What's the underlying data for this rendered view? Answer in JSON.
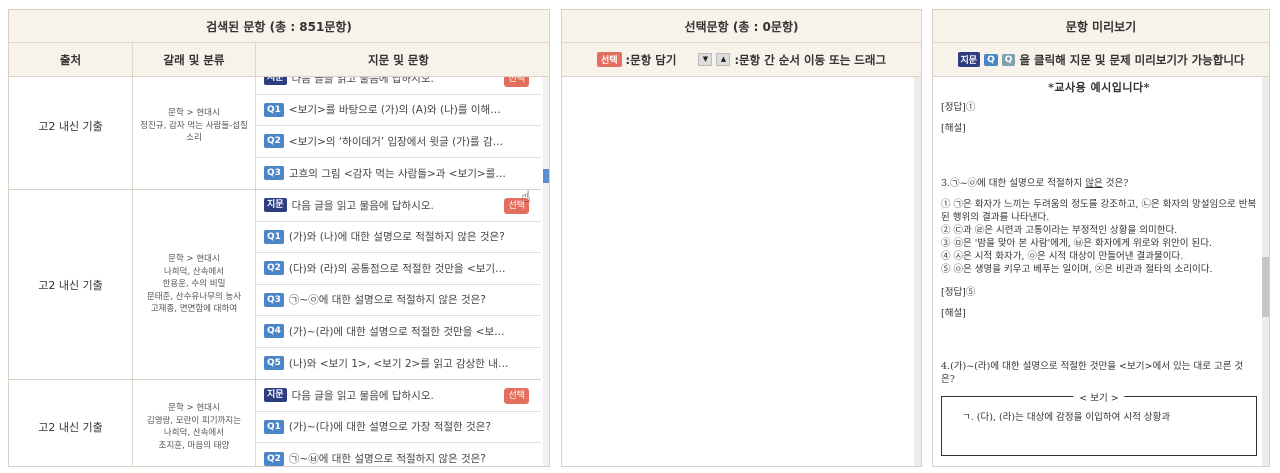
{
  "search_panel": {
    "title": "검색된 문항 (총 : 851문항)",
    "columns": [
      "출처",
      "갈래 및 분류",
      "지문 및 문항"
    ],
    "select_label": "선택",
    "groups": [
      {
        "source": "고2 내신 기출",
        "classification": "문학 > 현대시\n정진규, 감자 먹는 사람들-섭질\n소리",
        "items": [
          {
            "tag": "지문",
            "text": "다음 글을 읽고 물음에 답하시오."
          },
          {
            "tag": "Q1",
            "text": "<보기>를 바탕으로 (가)의 (A)와 (나)를 이해한 내…"
          },
          {
            "tag": "Q2",
            "text": "<보기>의 ‘하이데거’ 입장에서 윗글 (가)를 감상…"
          },
          {
            "tag": "Q3",
            "text": "고흐의 그림 <감자 먹는 사람들>과 <보기>를 비…"
          }
        ]
      },
      {
        "source": "고2 내신 기출",
        "classification": "문학 > 현대시\n나희덕, 산속에서\n한용운, 수의 비밀\n문태준, 산수유나무의 농사\n고재종, 면면함에 대하여",
        "items": [
          {
            "tag": "지문",
            "text": "다음 글을 읽고 물음에 답하시오."
          },
          {
            "tag": "Q1",
            "text": "(가)와 (나)에 대한 설명으로 적절하지 않은 것은?"
          },
          {
            "tag": "Q2",
            "text": "(다)와 (라)의 공통점으로 적절한 것만을 <보기>…"
          },
          {
            "tag": "Q3",
            "text": "㉠~㉧에 대한 설명으로 적절하지 않은 것은?"
          },
          {
            "tag": "Q4",
            "text": "(가)~(라)에 대한 설명으로 적절한 것만을 <보기>…"
          },
          {
            "tag": "Q5",
            "text": "(나)와 <보기 1>, <보기 2>를 읽고 감상한 내용으…"
          }
        ]
      },
      {
        "source": "고2 내신 기출",
        "classification": "문학 > 현대시\n김영랑, 모란이 피기까지는\n나희덕, 산속에서\n조지훈, 마음의 태양",
        "items": [
          {
            "tag": "지문",
            "text": "다음 글을 읽고 물음에 답하시오."
          },
          {
            "tag": "Q1",
            "text": "(가)~(다)에 대한 설명으로 가장 적절한 것은?"
          },
          {
            "tag": "Q2",
            "text": "㉠~㉥에 대한 설명으로 적절하지 않은 것은?"
          }
        ]
      }
    ]
  },
  "selected_panel": {
    "title": "선택문항 (총 : 0문항)",
    "hint_select_tag": "선택",
    "hint_select_text": ":문항 담기",
    "hint_move_down": "▼",
    "hint_move_up": "▲",
    "hint_move_text": ":문항 간 순서 이동 또는 드래그"
  },
  "preview_panel": {
    "title": "문항 미리보기",
    "hint_tag_j": "지문",
    "hint_tag_q": "Q",
    "hint_tag_q2": "Q",
    "hint_text": "을 클릭해 지문 및 문제 미리보기가 가능합니다",
    "content": {
      "heading": "*교사용 예시입니다*",
      "answer1": "[정답]①",
      "explain1": "[해설]",
      "q3_prefix": "3.㉠~㉧에 대한 설명으로 적절하지 ",
      "q3_underline": "않은",
      "q3_suffix": " 것은?",
      "opt1": "① ㉠은 화자가 느끼는 두려움의 정도를 강조하고, ㉡은 화자의 망설임으로 반복된 행위의 결과를 나타낸다.",
      "opt2": "② ㉢과 ㉣은 시련과 고통이라는 부정적인 상황을 의미한다.",
      "opt3": "③ ㉤은 '밤을 맞아 본 사람'에게, ㉥은 화자에게 위로와 위안이 된다.",
      "opt4": "④ ㉦은 시적 화자가, ㉧은 시적 대상이 만들어낸 결과물이다.",
      "opt5": "⑤ ㉧은 생명을 키우고 베푸는 일이며, ㉨은 비관과 절타의 소리이다.",
      "answer2": "[정답]⑤",
      "explain2": "[해설]",
      "q4": "4.(가)~(라)에 대한 설명으로 적절한 것만을 <보기>에서 있는 대로 고른 것은?",
      "box_label": "< 보기 >",
      "box_line": "ㄱ. (다), (라)는 대상에 감정을 이입하여 시적 상황과"
    }
  }
}
